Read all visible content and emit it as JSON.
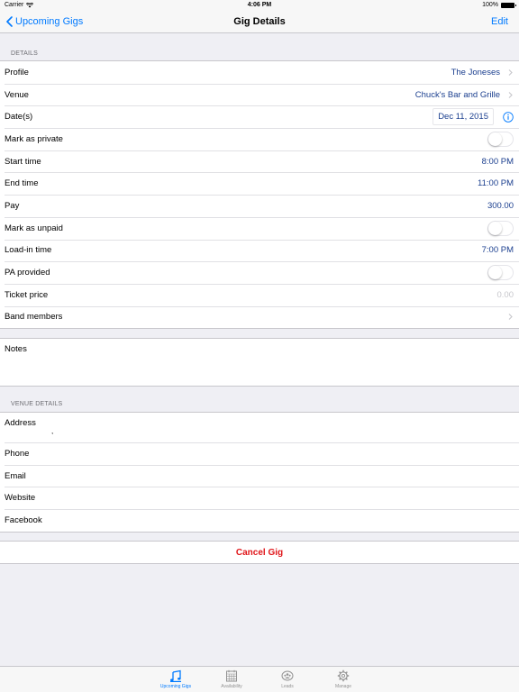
{
  "status": {
    "carrier": "Carrier",
    "time": "4:06 PM",
    "battery": "100%"
  },
  "nav": {
    "back_label": "Upcoming Gigs",
    "title": "Gig Details",
    "edit_label": "Edit"
  },
  "details": {
    "header": "DETAILS",
    "rows": [
      {
        "label": "Profile",
        "value": "The Joneses"
      },
      {
        "label": "Venue",
        "value": "Chuck's Bar and Grille"
      },
      {
        "label": "Date(s)",
        "value": "Dec 11, 2015"
      },
      {
        "label": "Mark as private",
        "toggle": false
      },
      {
        "label": "Start time",
        "value": "8:00 PM"
      },
      {
        "label": "End time",
        "value": "11:00 PM"
      },
      {
        "label": "Pay",
        "value": "300.00"
      },
      {
        "label": "Mark as unpaid",
        "toggle": false
      },
      {
        "label": "Load-in time",
        "value": "7:00 PM"
      },
      {
        "label": "PA provided",
        "toggle": false
      },
      {
        "label": "Ticket price",
        "placeholder": "0.00"
      },
      {
        "label": "Band members"
      }
    ]
  },
  "notes": {
    "label": "Notes"
  },
  "venue_details": {
    "header": "VENUE DETAILS",
    "address_label": "Address",
    "address_value": ",",
    "phone_label": "Phone",
    "email_label": "Email",
    "website_label": "Website",
    "facebook_label": "Facebook"
  },
  "actions": {
    "cancel_label": "Cancel Gig"
  },
  "tabs": [
    {
      "label": "Upcoming Gigs",
      "icon": "music-notes-icon",
      "active": true
    },
    {
      "label": "Availability",
      "icon": "calendar-icon",
      "active": false
    },
    {
      "label": "Leads",
      "icon": "leads-icon",
      "active": false
    },
    {
      "label": "Manage",
      "icon": "gear-icon",
      "active": false
    }
  ],
  "colors": {
    "accent": "#007aff",
    "value_text": "#1b3f8f",
    "destructive": "#e0161a",
    "background": "#efeff4"
  }
}
